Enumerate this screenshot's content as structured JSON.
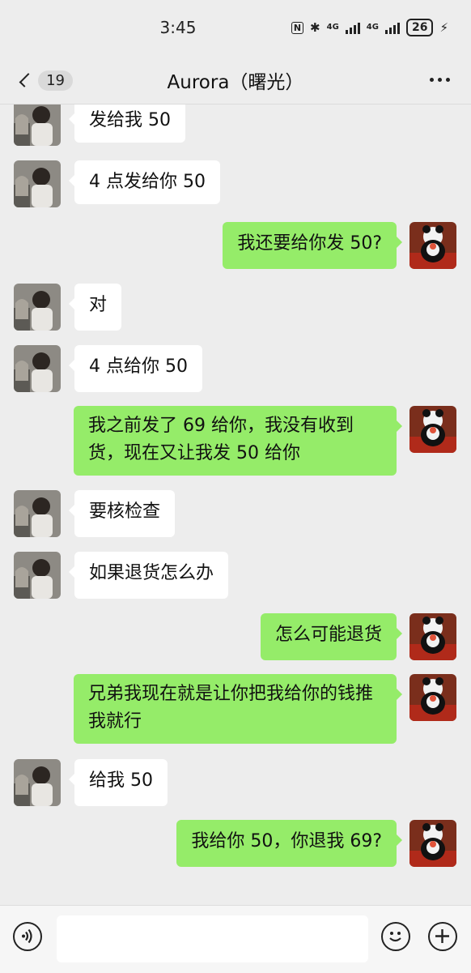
{
  "status_bar": {
    "time": "3:45",
    "nfc_label": "N",
    "bluetooth_icon": "bluetooth-icon",
    "network_1": "4G",
    "network_2": "4G",
    "battery": "26"
  },
  "header": {
    "unread_count": "19",
    "title": "Aurora（曙光）"
  },
  "messages": [
    {
      "side": "left",
      "text": "发给我 50"
    },
    {
      "side": "left",
      "text": "4 点发给你 50"
    },
    {
      "side": "right",
      "text": "我还要给你发 50?"
    },
    {
      "side": "left",
      "text": "对"
    },
    {
      "side": "left",
      "text": "4 点给你 50"
    },
    {
      "side": "right",
      "text": "我之前发了 69 给你，我没有收到货，现在又让我发 50 给你"
    },
    {
      "side": "left",
      "text": "要核检查"
    },
    {
      "side": "left",
      "text": "如果退货怎么办"
    },
    {
      "side": "right",
      "text": "怎么可能退货"
    },
    {
      "side": "right",
      "text": "兄弟我现在就是让你把我给你的钱推我就行"
    },
    {
      "side": "left",
      "text": "给我 50"
    },
    {
      "side": "right",
      "text": "我给你 50，你退我 69?"
    }
  ],
  "input": {
    "placeholder": ""
  },
  "colors": {
    "background": "#ededed",
    "sent_bubble": "#95ec69",
    "received_bubble": "#ffffff"
  }
}
